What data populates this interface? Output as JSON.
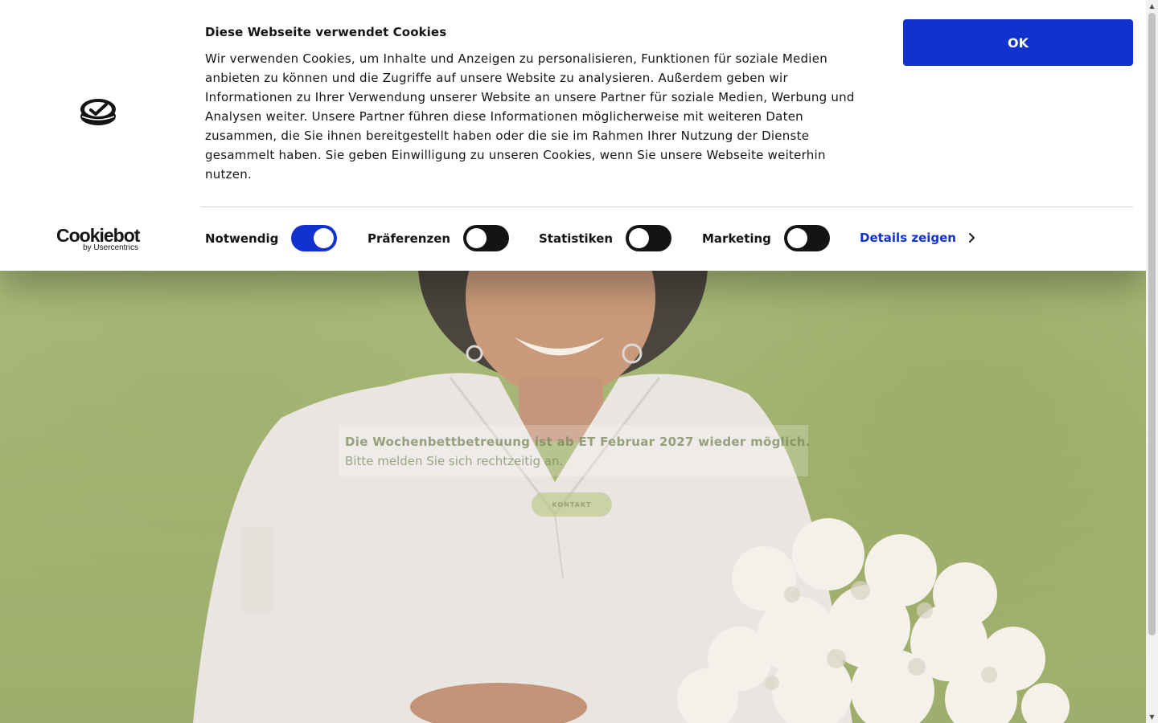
{
  "hero": {
    "notice_line1": "Die Wochenbettbetreuung ist ab ET Februar 2027 wieder möglich.",
    "notice_line2": "Bitte melden Sie sich rechtzeitig an.",
    "contact_button": "KONTAKT"
  },
  "cookie_banner": {
    "title": "Diese Webseite verwendet Cookies",
    "text": "Wir verwenden Cookies, um Inhalte und Anzeigen zu personalisieren, Funktionen für soziale Medien anbieten zu können und die Zugriffe auf unsere Website zu analysieren. Außerdem geben wir Informationen zu Ihrer Verwendung unserer Website an unsere Partner für soziale Medien, Werbung und Analysen weiter. Unsere Partner führen diese Informationen möglicherweise mit weiteren Daten zusammen, die Sie ihnen bereitgestellt haben oder die sie im Rahmen Ihrer Nutzung der Dienste gesammelt haben. Sie geben Einwilligung zu unseren Cookies, wenn Sie unsere Webseite weiterhin nutzen.",
    "ok_button": "OK",
    "brand_name": "Cookiebot",
    "brand_sub": "by Usercentrics",
    "toggles": [
      {
        "label": "Notwendig",
        "checked": true
      },
      {
        "label": "Präferenzen",
        "checked": false
      },
      {
        "label": "Statistiken",
        "checked": false
      },
      {
        "label": "Marketing",
        "checked": false
      }
    ],
    "details_link": "Details zeigen",
    "icons": {
      "logo": "cookiebot-logo-icon",
      "chevron": "chevron-right-icon"
    },
    "colors": {
      "accent": "#1032cf",
      "text": "#141414",
      "toggle_off": "#141414"
    }
  }
}
